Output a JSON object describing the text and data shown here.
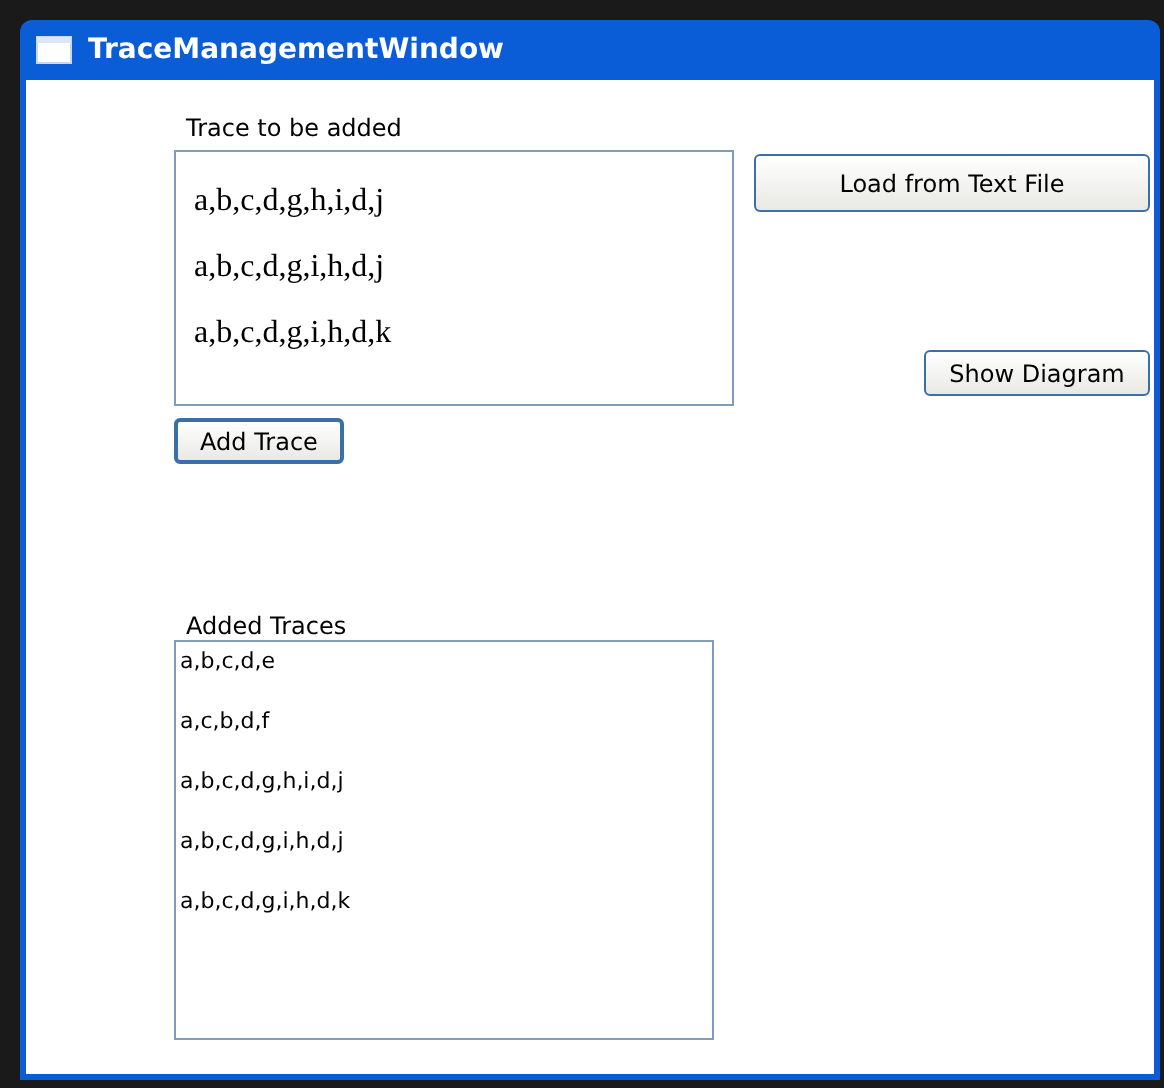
{
  "window": {
    "title": "TraceManagementWindow"
  },
  "trace_input": {
    "label": "Trace to be added",
    "value": [
      "a,b,c,d,g,h,i,d,j",
      "a,b,c,d,g,i,h,d,j",
      "a,b,c,d,g,i,h,d,k"
    ]
  },
  "buttons": {
    "load": "Load from Text File",
    "show_diagram": "Show Diagram",
    "add": "Add Trace"
  },
  "added_traces": {
    "label": "Added Traces",
    "items": [
      "a,b,c,d,e",
      "a,c,b,d,f",
      "a,b,c,d,g,h,i,d,j",
      "a,b,c,d,g,i,h,d,j",
      "a,b,c,d,g,i,h,d,k"
    ]
  }
}
